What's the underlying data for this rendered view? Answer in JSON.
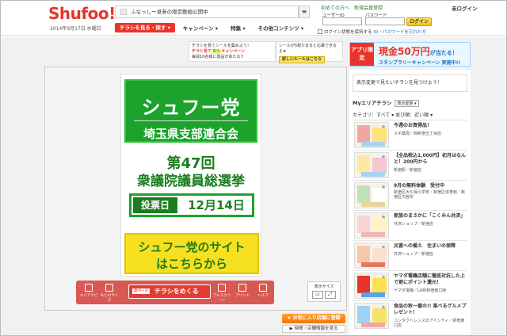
{
  "header": {
    "logo": "Shufoo!",
    "date": "2014年9月17日 水曜日",
    "notice": "ふなっしー見参の限定動画公開中",
    "notice_menu": "≡",
    "nav": [
      {
        "label": "チラシを見る・探す ▾",
        "primary": true
      },
      {
        "label": "キャンペーン ▾"
      },
      {
        "label": "特集 ▾"
      },
      {
        "label": "その他コンテンツ ▾"
      }
    ],
    "top_links": {
      "first": "初めての方へ",
      "register": "新規会員登録",
      "mylogin": "未ログイン"
    },
    "login": {
      "user_label": "ユーザーID",
      "pass_label": "パスワード",
      "button": "ログイン",
      "remember": "ログイン状態を保持する",
      "forgot": "ID・パスワードを忘れた方"
    }
  },
  "promos": {
    "p1_line1": "チラシを見てシールを集めよう！",
    "p1_line2": "チラシ見て",
    "p1_hl": "5つ",
    "p1_line2b": "キャンペーン",
    "p1_line3": "毎週10名様に賞品があたる!!",
    "p2_line1": "シールが5枚たまると応募できるよ★",
    "p2_button": "詳しいルールはこちら",
    "p3_left": "アプリ限定",
    "p3_main": "現金50万円",
    "p3_main_suffix": "が当たる！",
    "p3_sub": "スタンプラリーキャンペーン 実施中!!"
  },
  "flyer": {
    "party": "シュフー党",
    "branch": "埼玉県支部連合会",
    "election_1": "第47回",
    "election_2": "衆議院議員総選挙",
    "vote_label": "投票日",
    "vote_date": "12月14日",
    "cta_1": "シュフー党のサイト",
    "cta_2": "はこちらから"
  },
  "toolbar": {
    "area_map": "エリアナビ",
    "original_size": "もとのサイズ",
    "flip_tag": "次ページ",
    "flip": "チラシをめくる",
    "fullscreen": "フルスクリーン",
    "print": "プリント",
    "help": "ヘルプ",
    "display_size": "表示サイズ",
    "fav": "★ お気に入り店舗に登録",
    "hours": "▶ 時間・店舗情報を見る"
  },
  "sidebar": {
    "search_msg": "表示変更で見たいチラシを見つけよう！",
    "area_title": "Myエリアチラシ",
    "display_change": "表示変更 ▾",
    "filter": "カテゴリ：すべて ▾  並び順：近い順 ▾",
    "items": [
      {
        "title": "今週のお買得品！",
        "shop": "スギ薬局／西新宿五丁目店"
      },
      {
        "title": "【全品税込1,000円】初月はなんと！200円から",
        "shop": "新宿駅／新宿店"
      },
      {
        "title": "9月の無料体験　受付中",
        "shop": "新宿区大久保小学校・新宿区体育館／新宿区内各所"
      },
      {
        "title": "家族のまさかに「こくみん共済」",
        "shop": "共済ショップ／新宿店"
      },
      {
        "title": "災害への備え　住まいの保障",
        "shop": "共済ショップ／新宿店"
      },
      {
        "title": "ヤマダ電機店舗に徹底対抗した上で更にポイント還元！",
        "shop": "ヤマダ電機／LABI新宿東口館"
      },
      {
        "title": "食品の秋一番の!! 楽べるグルメプレゼント！",
        "shop": "コンタクトレンズのアイシティ／新宿東口店"
      }
    ]
  }
}
